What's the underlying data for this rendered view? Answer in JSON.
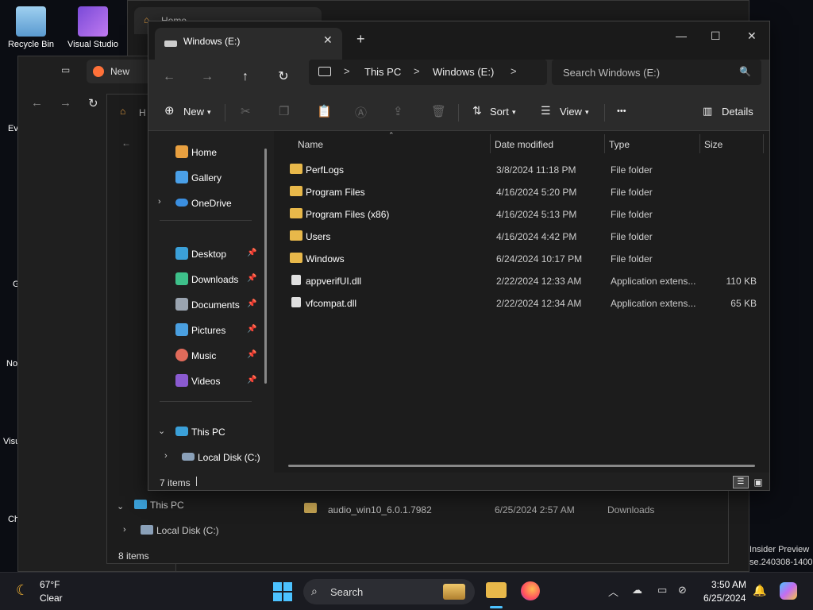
{
  "desktop": {
    "icons": [
      {
        "label": "Recycle Bin"
      },
      {
        "label": "Visual Studio"
      }
    ],
    "watermark": [
      "Insider Preview",
      "se.240308-1400"
    ]
  },
  "background_windows": {
    "back_tab_label": "Home",
    "browser_tab_label": "New",
    "mid_tab_label": "H",
    "lower_sidebar_thispc": "This PC",
    "lower_sidebar_localdisk": "Local Disk (C:)",
    "lower_row": {
      "name": "audio_win10_6.0.1.7982",
      "date": "6/25/2024 2:57 AM",
      "type": "Downloads"
    },
    "lower_status": "8 items",
    "left_partial_labels": [
      "Ev",
      "G",
      "No",
      "Visu",
      "Ch"
    ]
  },
  "window": {
    "tab_label": "Windows (E:)",
    "close_tab_glyph": "✕",
    "new_tab_glyph": "+",
    "controls": {
      "minimize": "—",
      "maximize": "☐",
      "close": "✕"
    }
  },
  "nav": {
    "back": "←",
    "forward": "→",
    "up": "↑",
    "refresh": "↻"
  },
  "address": {
    "segments": [
      "This PC",
      "Windows (E:)"
    ],
    "separator": ">"
  },
  "search": {
    "placeholder": "Search Windows (E:)"
  },
  "toolbar": {
    "new_label": "New",
    "sort_label": "Sort",
    "view_label": "View",
    "more_label": "•••",
    "details_label": "Details"
  },
  "sidebar": {
    "top_items": [
      {
        "label": "Home",
        "icon": "home-icon",
        "color": "#e8a040"
      },
      {
        "label": "Gallery",
        "icon": "gallery-icon",
        "color": "#4aa0e8"
      },
      {
        "label": "OneDrive",
        "icon": "onedrive-icon",
        "color": "#3b8fe0"
      }
    ],
    "pinned_items": [
      {
        "label": "Desktop",
        "icon": "desktop-icon",
        "color": "#3ba0d8"
      },
      {
        "label": "Downloads",
        "icon": "downloads-icon",
        "color": "#3ec08a"
      },
      {
        "label": "Documents",
        "icon": "documents-icon",
        "color": "#9aa4b0"
      },
      {
        "label": "Pictures",
        "icon": "pictures-icon",
        "color": "#4a9fe0"
      },
      {
        "label": "Music",
        "icon": "music-icon",
        "color": "#e06a5a"
      },
      {
        "label": "Videos",
        "icon": "videos-icon",
        "color": "#8a5ad0"
      }
    ],
    "pin_glyph": "📌",
    "thispc": "This PC",
    "localdisk": "Local Disk (C:)"
  },
  "columns": {
    "name": "Name",
    "date": "Date modified",
    "type": "Type",
    "size": "Size"
  },
  "rows": [
    {
      "name": "PerfLogs",
      "date": "3/8/2024 11:18 PM",
      "type": "File folder",
      "size": "",
      "kind": "folder"
    },
    {
      "name": "Program Files",
      "date": "4/16/2024 5:20 PM",
      "type": "File folder",
      "size": "",
      "kind": "folder"
    },
    {
      "name": "Program Files (x86)",
      "date": "4/16/2024 5:13 PM",
      "type": "File folder",
      "size": "",
      "kind": "folder"
    },
    {
      "name": "Users",
      "date": "4/16/2024 4:42 PM",
      "type": "File folder",
      "size": "",
      "kind": "folder"
    },
    {
      "name": "Windows",
      "date": "6/24/2024 10:17 PM",
      "type": "File folder",
      "size": "",
      "kind": "folder"
    },
    {
      "name": "appverifUI.dll",
      "date": "2/22/2024 12:33 AM",
      "type": "Application extens...",
      "size": "110 KB",
      "kind": "file"
    },
    {
      "name": "vfcompat.dll",
      "date": "2/22/2024 12:34 AM",
      "type": "Application extens...",
      "size": "65 KB",
      "kind": "file"
    }
  ],
  "status": {
    "items": "7 items"
  },
  "taskbar": {
    "weather_temp": "67°F",
    "weather_desc": "Clear",
    "search_label": "Search",
    "time": "3:50 AM",
    "date": "6/25/2024"
  },
  "colors": {
    "folder": "#e8b84a",
    "accent": "#4cc2ff",
    "window_bg": "#202020",
    "titlebar_bg": "#1a1a1a"
  }
}
